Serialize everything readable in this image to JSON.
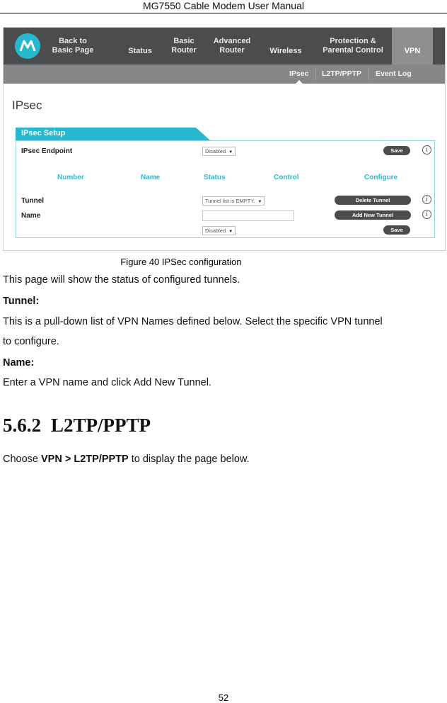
{
  "document": {
    "running_header": "MG7550 Cable Modem User Manual",
    "page_number": "52"
  },
  "figure": {
    "caption": "Figure 40 IPSec configuration",
    "app": {
      "brand_color": "#27b8cf",
      "nav_color": "#4b4c4e",
      "top_nav": [
        {
          "label": "Back to\nBasic Page",
          "active": false
        },
        {
          "label": "Status",
          "active": false
        },
        {
          "label": "Basic\nRouter",
          "active": false
        },
        {
          "label": "Advanced\nRouter",
          "active": false
        },
        {
          "label": "Wireless",
          "active": false
        },
        {
          "label": "Protection &\nParental Control",
          "active": false
        },
        {
          "label": "VPN",
          "active": true
        }
      ],
      "sub_nav": [
        {
          "label": "IPsec",
          "active": true
        },
        {
          "label": "L2TP/PPTP",
          "active": false
        },
        {
          "label": "Event Log",
          "active": false
        }
      ],
      "page_title": "IPsec",
      "panel": {
        "tab_label": "IPsec Setup",
        "endpoint": {
          "label": "IPsec Endpoint",
          "select_value": "Disabled",
          "save_label": "Save"
        },
        "columns": [
          "Number",
          "Name",
          "Status",
          "Control",
          "Configure"
        ],
        "tunnel": {
          "label": "Tunnel",
          "select_value": "Tunnel list is EMPTY.",
          "delete_label": "Delete Tunnel"
        },
        "name": {
          "label": "Name",
          "input_value": "",
          "add_label": "Add New Tunnel"
        },
        "state": {
          "select_value": "Disabled",
          "save_label": "Save"
        }
      }
    }
  },
  "body": {
    "intro": "This page will show the status of configured tunnels.",
    "tunnel_heading": "Tunnel:",
    "tunnel_text_line1": "This is a pull-down list of VPN Names defined below. Select the specific VPN tunnel",
    "tunnel_text_line2": "to configure.",
    "name_heading": "Name:",
    "name_text": "Enter a VPN name and click Add New Tunnel.",
    "section": {
      "number": "5.6.2",
      "title": "L2TP/PPTP"
    },
    "choose": {
      "prefix": "Choose ",
      "path": "VPN > L2TP/PPTP",
      "suffix": " to display the page below."
    }
  }
}
